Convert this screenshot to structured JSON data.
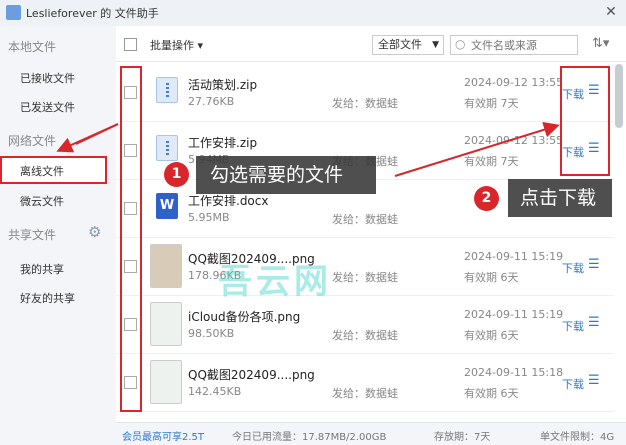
{
  "window": {
    "title": "Leslieforever 的 文件助手",
    "close_label": "✕"
  },
  "sidebar": {
    "local_head": "本地文件",
    "received": "已接收文件",
    "sent": "已发送文件",
    "network_head": "网络文件",
    "offline": "离线文件",
    "weiyun": "微云文件",
    "shared_head": "共享文件",
    "my_share": "我的共享",
    "friends_share": "好友的共享",
    "icons": {
      "gear": "gear-icon"
    }
  },
  "toolbar": {
    "batch_label": "批量操作 ▾",
    "filter_value": "全部文件",
    "filter_arrow": "▼",
    "search_placeholder": "文件名或来源",
    "search_icon": "○",
    "sort_icon": "⇅▾"
  },
  "files": [
    {
      "name": "活动策划.zip",
      "size": "27.76KB",
      "sender": "发给：数据蛙",
      "date": "2024-09-12 13:55",
      "expire": "有效期 7天",
      "action": "下载",
      "type": "zip"
    },
    {
      "name": "工作安排.zip",
      "size": "5.94MB",
      "sender": "发给：数据蛙",
      "date": "2024-09-12 13:55",
      "expire": "有效期 7天",
      "action": "下载",
      "type": "zip"
    },
    {
      "name": "工作安排.docx",
      "size": "5.95MB",
      "sender": "发给：数据蛙",
      "date": "",
      "expire": "",
      "action": "",
      "type": "doc",
      "icon_letter": "W"
    },
    {
      "name": "QQ截图202409....png",
      "size": "178.96KB",
      "sender": "发给：数据蛙",
      "date": "2024-09-11 15:19",
      "expire": "有效期 6天",
      "action": "下载",
      "type": "img"
    },
    {
      "name": "iCloud备份各项.png",
      "size": "98.50KB",
      "sender": "发给：数据蛙",
      "date": "2024-09-11 15:19",
      "expire": "有效期 6天",
      "action": "下载",
      "type": "img2"
    },
    {
      "name": "QQ截图202409....png",
      "size": "142.45KB",
      "sender": "发给：数据蛙",
      "date": "2024-09-11 15:18",
      "expire": "有效期 6天",
      "action": "下载",
      "type": "img2"
    }
  ],
  "row_menu_icon": "☰",
  "status": {
    "quota": "会员最高可享2.5T",
    "traffic": "今日已用流量：17.87MB/2.00GB",
    "storage": "存放期：7天",
    "limit": "单文件限制：4G"
  },
  "annotations": {
    "badge1": "1",
    "text1": "勾选需要的文件",
    "badge2": "2",
    "text2": "点击下载",
    "color": "#d9262b"
  },
  "watermark": "吾云网"
}
